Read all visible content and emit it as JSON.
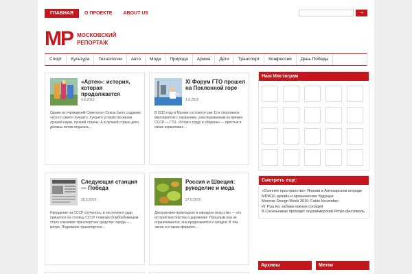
{
  "top_nav": [
    {
      "label": "ГЛАВНАЯ",
      "active": true
    },
    {
      "label": "О ПРОЕКТЕ",
      "active": false
    },
    {
      "label": "ABOUT US",
      "active": false
    }
  ],
  "search": {
    "button_label": "→"
  },
  "logo": {
    "mark": "МР",
    "text": "МОСКОВСКИЙ РЕПОРТАЖ"
  },
  "categories": [
    "Спорт",
    "Культура",
    "Технологии",
    "Авто",
    "Мода",
    "Природа",
    "Армия",
    "Дети",
    "Транспорт",
    "Конфессии",
    "День Победы"
  ],
  "posts": [
    {
      "title": "«Артек»: история, которая продолжается",
      "date": "4.6.2015",
      "excerpt": "Одним из учреждений Советского Союза было создание чего-то самого лучшего: лучшего устройства жизни, лучшей науки, лучшей страны. А в лучшей стране дети должны летом отдыхать…"
    },
    {
      "title": "XI Форум ГТО прошел на Поклонной горе",
      "date": "1.6.2015",
      "excerpt": "В 2015 году в Москве состоялся уже 11-е спортивное мероприятие с названием, унаследованным из времен СССР — ГТО. «Готов к труду и обороне» — простые в своих нормативах…"
    },
    {
      "title": "Следующая станция — Победа",
      "date": "28.5.2015",
      "excerpt": "Нападение на СССР случилось, и постепенно удар пришелся на столицу СССР. Главным бомбоубежищем стало ключевое транспортное средство города — метро. Подземное транспортное…"
    },
    {
      "title": "Россия и Швеция: рукоделие и мода",
      "date": "27.5.2015",
      "excerpt": "Декоративно-прикладное и народное искусство — это история мастерства и дарования. Прошлым она не ограничивается, она продолжается и сегодня. В том числе и в таком формате,…"
    }
  ],
  "sidebar": {
    "instagram_title": "Наш Инстаграм",
    "see_also_title": "Смотреть еще:",
    "see_also_links": [
      "«Осеннее пространство» Японии в Аптекарском огороде",
      "MDW11: дизайн и органическое будущее",
      "Moscow Design Week 2010: Fabio Novembre",
      "Иг Руш Ка: забавы южных соседей",
      "В Сокольниках проходит олдтаймерский Ретро-фестиваль"
    ],
    "archives_title": "Архивы",
    "tags_title": "Метки"
  },
  "colors": {
    "accent": "#c4161c",
    "background": "#eeeeee"
  }
}
